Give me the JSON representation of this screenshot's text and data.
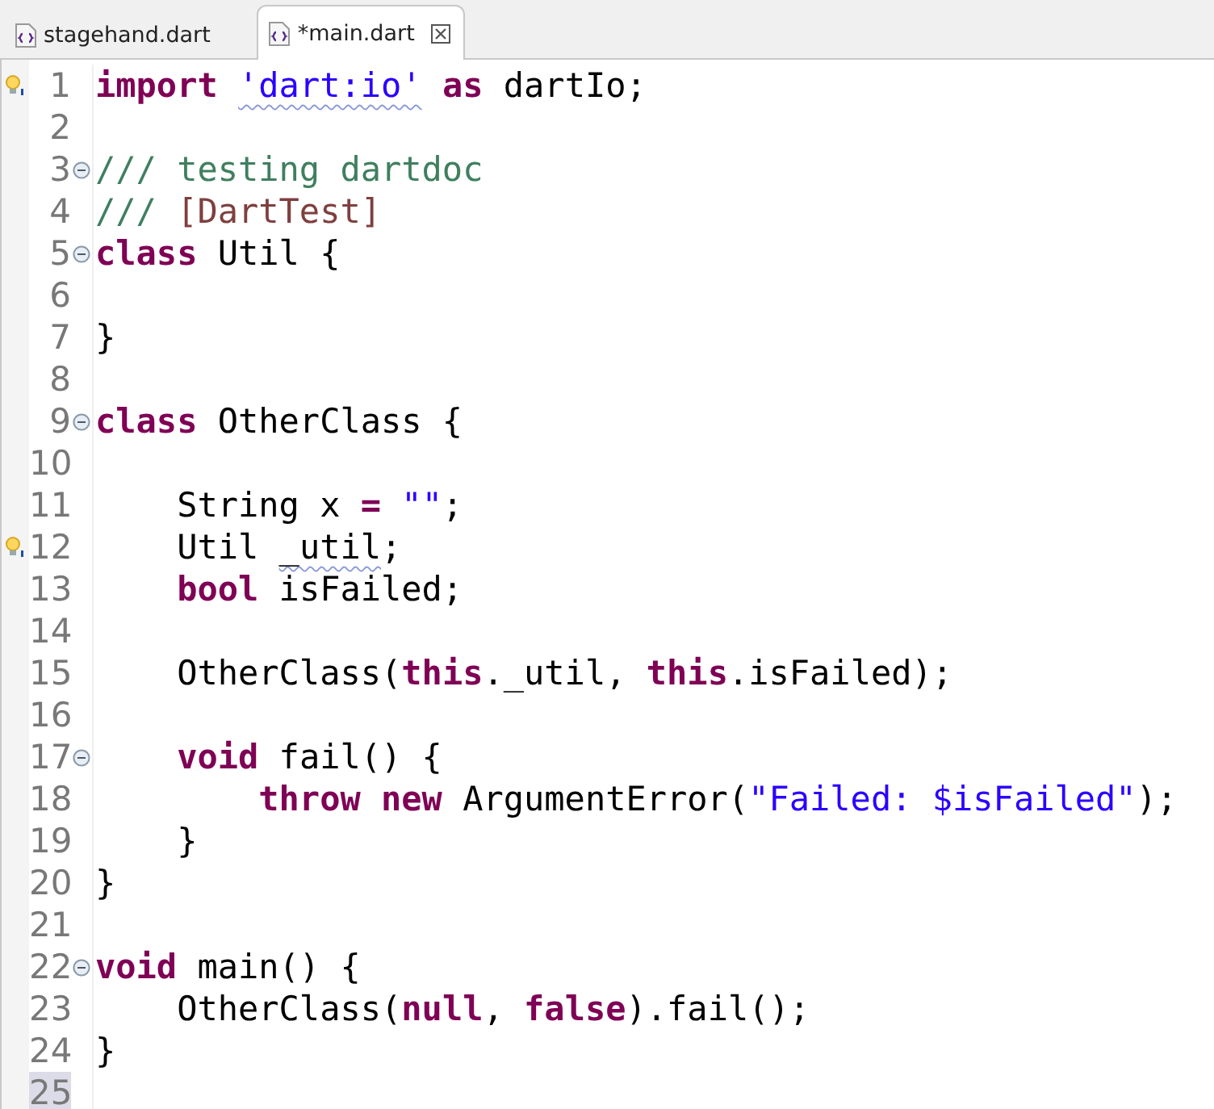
{
  "tabs": [
    {
      "label": "stagehand.dart",
      "selected": false,
      "closable": false
    },
    {
      "label": "*main.dart",
      "selected": true,
      "closable": true
    }
  ],
  "editor": {
    "lines": [
      {
        "number": "1",
        "fold": false,
        "marker": true,
        "current": false,
        "tokens": [
          {
            "kind": "keyword",
            "text": "import "
          },
          {
            "kind": "string",
            "text": "'dart:io'",
            "warning": true
          },
          {
            "kind": "keyword",
            "text": " as"
          },
          {
            "kind": "plain",
            "text": " dartIo;"
          }
        ]
      },
      {
        "number": "2",
        "fold": false,
        "marker": false,
        "current": false
      },
      {
        "number": "3",
        "fold": true,
        "marker": false,
        "current": false,
        "tokens": [
          {
            "kind": "comment",
            "text": "/// testing dartdoc"
          }
        ]
      },
      {
        "number": "4",
        "fold": false,
        "marker": false,
        "current": false,
        "tokens": [
          {
            "kind": "comment",
            "text": "/// "
          },
          {
            "kind": "docref",
            "text": "[DartTest]"
          }
        ]
      },
      {
        "number": "5",
        "fold": true,
        "marker": false,
        "current": false,
        "tokens": [
          {
            "kind": "keyword",
            "text": "class"
          },
          {
            "kind": "plain",
            "text": " Util {"
          }
        ]
      },
      {
        "number": "6",
        "fold": false,
        "marker": false,
        "current": false
      },
      {
        "number": "7",
        "fold": false,
        "marker": false,
        "current": false,
        "tokens": [
          {
            "kind": "plain",
            "text": "}"
          }
        ]
      },
      {
        "number": "8",
        "fold": false,
        "marker": false,
        "current": false
      },
      {
        "number": "9",
        "fold": true,
        "marker": false,
        "current": false,
        "tokens": [
          {
            "kind": "keyword",
            "text": "class"
          },
          {
            "kind": "plain",
            "text": " OtherClass {"
          }
        ]
      },
      {
        "number": "10",
        "fold": false,
        "marker": false,
        "current": false
      },
      {
        "number": "11",
        "fold": false,
        "marker": false,
        "current": false,
        "tokens": [
          {
            "kind": "plain",
            "text": "    String x "
          },
          {
            "kind": "keyword",
            "text": "="
          },
          {
            "kind": "string",
            "text": " \"\""
          },
          {
            "kind": "plain",
            "text": ";"
          }
        ]
      },
      {
        "number": "12",
        "fold": false,
        "marker": true,
        "current": false,
        "tokens": [
          {
            "kind": "plain",
            "text": "    Util "
          },
          {
            "kind": "plain",
            "text": "_util",
            "warning": true
          },
          {
            "kind": "plain",
            "text": ";"
          }
        ]
      },
      {
        "number": "13",
        "fold": false,
        "marker": false,
        "current": false,
        "tokens": [
          {
            "kind": "keyword",
            "text": "    bool"
          },
          {
            "kind": "plain",
            "text": " isFailed;"
          }
        ]
      },
      {
        "number": "14",
        "fold": false,
        "marker": false,
        "current": false
      },
      {
        "number": "15",
        "fold": false,
        "marker": false,
        "current": false,
        "tokens": [
          {
            "kind": "plain",
            "text": "    OtherClass("
          },
          {
            "kind": "keyword",
            "text": "this"
          },
          {
            "kind": "plain",
            "text": "._util, "
          },
          {
            "kind": "keyword",
            "text": "this"
          },
          {
            "kind": "plain",
            "text": ".isFailed);"
          }
        ]
      },
      {
        "number": "16",
        "fold": false,
        "marker": false,
        "current": false
      },
      {
        "number": "17",
        "fold": true,
        "marker": false,
        "current": false,
        "tokens": [
          {
            "kind": "keyword",
            "text": "    void"
          },
          {
            "kind": "plain",
            "text": " fail() {"
          }
        ]
      },
      {
        "number": "18",
        "fold": false,
        "marker": false,
        "current": false,
        "tokens": [
          {
            "kind": "keyword",
            "text": "        throw new"
          },
          {
            "kind": "plain",
            "text": " ArgumentError("
          },
          {
            "kind": "string",
            "text": "\"Failed: $isFailed\""
          },
          {
            "kind": "plain",
            "text": ");"
          }
        ]
      },
      {
        "number": "19",
        "fold": false,
        "marker": false,
        "current": false,
        "tokens": [
          {
            "kind": "plain",
            "text": "    }"
          }
        ]
      },
      {
        "number": "20",
        "fold": false,
        "marker": false,
        "current": false,
        "tokens": [
          {
            "kind": "plain",
            "text": "}"
          }
        ]
      },
      {
        "number": "21",
        "fold": false,
        "marker": false,
        "current": false
      },
      {
        "number": "22",
        "fold": true,
        "marker": false,
        "current": false,
        "tokens": [
          {
            "kind": "keyword",
            "text": "void"
          },
          {
            "kind": "plain",
            "text": " main() {"
          }
        ]
      },
      {
        "number": "23",
        "fold": false,
        "marker": false,
        "current": false,
        "tokens": [
          {
            "kind": "plain",
            "text": "    OtherClass("
          },
          {
            "kind": "keyword",
            "text": "null"
          },
          {
            "kind": "plain",
            "text": ", "
          },
          {
            "kind": "keyword",
            "text": "false"
          },
          {
            "kind": "plain",
            "text": ").fail();"
          }
        ]
      },
      {
        "number": "24",
        "fold": false,
        "marker": false,
        "current": false,
        "tokens": [
          {
            "kind": "plain",
            "text": "}"
          }
        ]
      },
      {
        "number": "25",
        "fold": false,
        "marker": false,
        "current": true
      }
    ]
  }
}
